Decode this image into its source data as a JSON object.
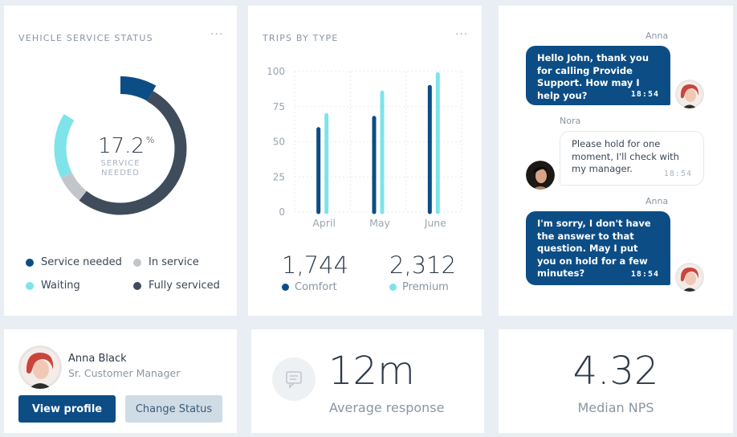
{
  "service_status": {
    "title": "VEHICLE SERVICE STATUS",
    "more": "···",
    "percent": "17.2",
    "percent_sign": "%",
    "sub_line1": "SERVICE",
    "sub_line2": "NEEDED",
    "legend": [
      {
        "label": "Service needed",
        "color": "#0c4d85"
      },
      {
        "label": "In service",
        "color": "#c2c6cb"
      },
      {
        "label": "Waiting",
        "color": "#7fe3ea"
      },
      {
        "label": "Fully serviced",
        "color": "#3e4c5c"
      }
    ]
  },
  "trips": {
    "title": "TRIPS BY TYPE",
    "more": "···",
    "comfort_total": "1,744",
    "comfort_label": "Comfort",
    "premium_total": "2,312",
    "premium_label": "Premium",
    "comfort_color": "#0c4d85",
    "premium_color": "#7fe3ea"
  },
  "chart_data": {
    "type": "bar",
    "categories": [
      "April",
      "May",
      "June"
    ],
    "series": [
      {
        "name": "Comfort",
        "values": [
          59,
          67,
          89
        ]
      },
      {
        "name": "Premium",
        "values": [
          69,
          85,
          98
        ]
      }
    ],
    "yticks": [
      0,
      25,
      50,
      75,
      100
    ],
    "ylim": [
      0,
      100
    ],
    "grid": true
  },
  "chat": {
    "messages": [
      {
        "sender": "Anna",
        "text": "Hello John, thank you for calling Provide Support. How may I help you?",
        "time": "18:54",
        "side": "out"
      },
      {
        "sender": "Nora",
        "text": "Please hold for one moment, I'll check with my manager.",
        "time": "18:54",
        "side": "in"
      },
      {
        "sender": "Anna",
        "text": "I'm sorry, I don't have the answer to that question. May I put you on hold for a few minutes?",
        "time": "18:54",
        "side": "out"
      }
    ]
  },
  "profile": {
    "name": "Anna Black",
    "role": "Sr. Customer Manager",
    "view_label": "View profile",
    "status_label": "Change Status"
  },
  "response": {
    "value": "12m",
    "label": "Average response",
    "icon": "chat-bubble-icon"
  },
  "nps": {
    "value": "4.32",
    "label": "Median NPS"
  }
}
